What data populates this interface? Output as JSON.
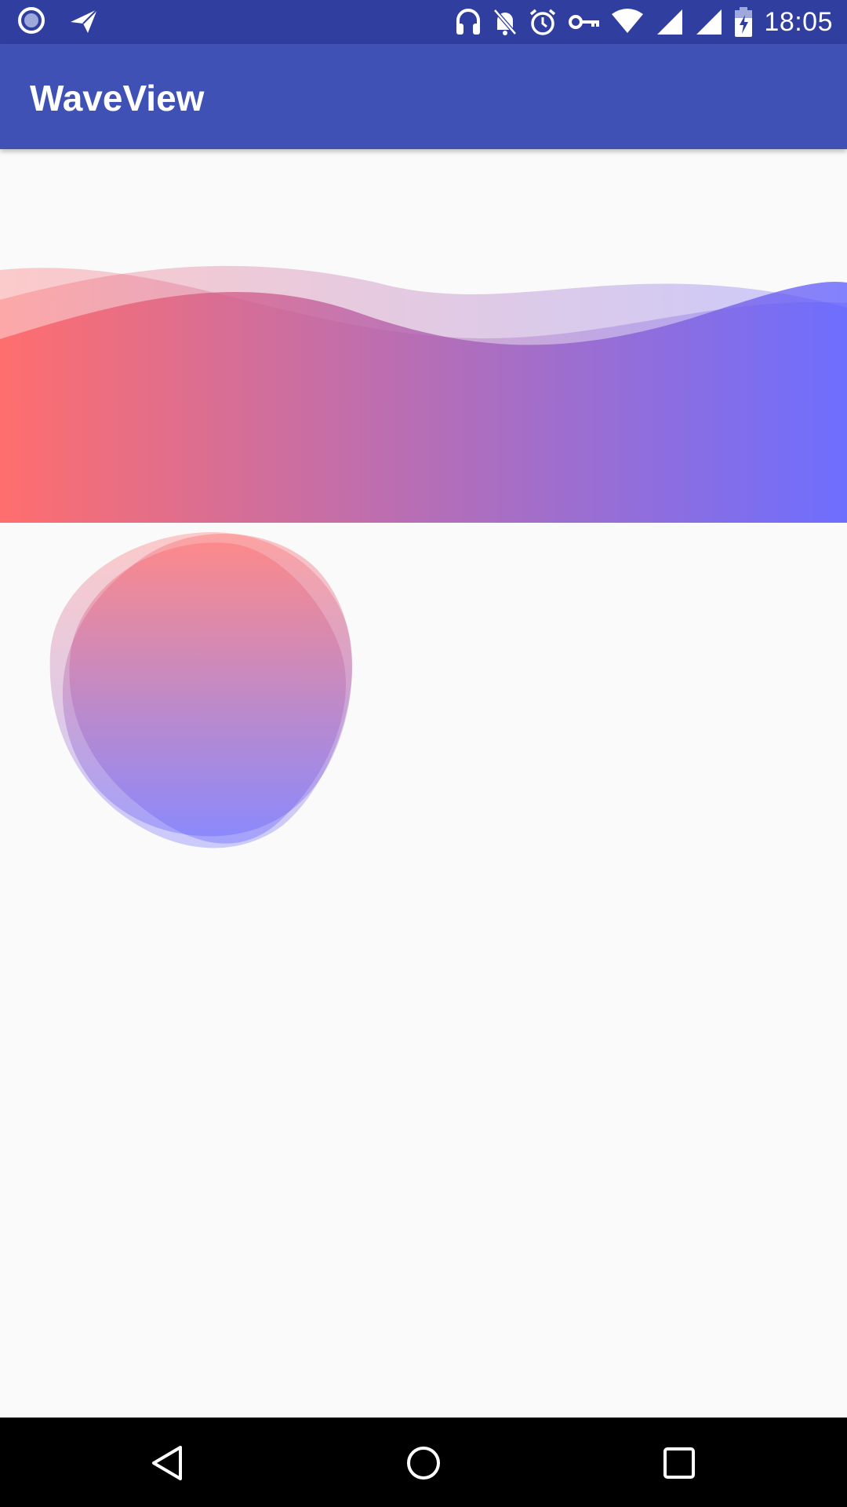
{
  "status_bar": {
    "time": "18:05",
    "left_icons": [
      "record-icon",
      "send-icon"
    ],
    "right_icons": [
      "headphones-icon",
      "notifications-off-icon",
      "alarm-icon",
      "vpn-key-icon",
      "wifi-icon",
      "signal-icon",
      "signal-icon",
      "battery-charging-icon"
    ]
  },
  "app_bar": {
    "title": "WaveView"
  },
  "colors": {
    "status_bar": "#303f9f",
    "app_bar": "#3f51b5",
    "gradient_start": "#ff5a5a",
    "gradient_end": "#5a5aff",
    "background": "#fafafa"
  },
  "nav_bar": {
    "buttons": [
      "back-icon",
      "home-icon",
      "recents-icon"
    ]
  }
}
